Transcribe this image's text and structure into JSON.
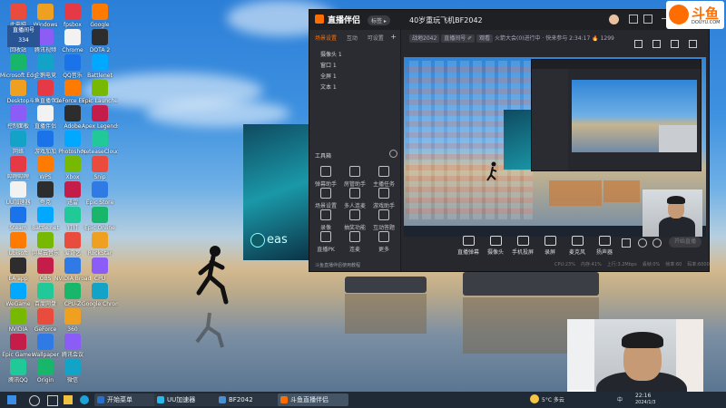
{
  "desktop": {
    "icons_col1": [
      "此电脑",
      "回收站",
      "Microsoft Edge",
      "Desktop",
      "控制面板",
      "网络",
      "哔哩哔哩",
      "UU加速器",
      "Steam",
      "Ubisoft",
      "EA app",
      "WeGame",
      "NVIDIA",
      "Epic Games",
      "腾讯QQ"
    ],
    "icons_col2": [
      "Windows",
      "腾讯视频",
      "企鹅电竞",
      "斗鱼直播伴侣",
      "直播伴侣",
      "游戏加加",
      "WPS",
      "夸克",
      "Battle.net",
      "网易云音乐",
      "OBS",
      "百度网盘",
      "GeForce",
      "Wallpaper",
      "Origin"
    ],
    "icons_col3": [
      "fpsbox",
      "Chrome",
      "QQ音乐",
      "GeForce Experience",
      "Adobe",
      "Photoshop",
      "Xbox",
      "迅雷",
      "钉钉",
      "爱奇艺",
      "NVIDIA Broadcast",
      "CPU-Z",
      "360",
      "腾讯会议",
      "微信"
    ],
    "icons_col4": [
      "Google",
      "DOTA 2",
      "Battlenet",
      "Epic Launcher",
      "Apex Legends",
      "NeteaseCloud",
      "Snip",
      "Epic Store",
      "Epic Online",
      "RockStar",
      "CPU",
      "Google Chrome"
    ],
    "cam_user_label": "直播间号",
    "cam_user_id": "334"
  },
  "streamer_app": {
    "brand": "直播伴侣",
    "badge": "标签 ▸",
    "room_title": "40岁重玩飞机BF2042",
    "room_meta_1": "战地2042",
    "room_meta_2": "直播间号 ✐",
    "room_meta_3": "观看",
    "room_meta_4": "火箭大会(0)进行中 · 快来参与",
    "room_time": "2:34:17",
    "room_viewers": "🔥 1299",
    "scene_tabs": [
      "场景设置",
      "互动",
      "可设置"
    ],
    "add_icon": "+",
    "sources": [
      "摄像头 1",
      "窗口 1",
      "全屏 1",
      "文本 1"
    ],
    "tools_header": "工具箱",
    "tools": [
      "弹幕助手",
      "房管助手",
      "主播任务",
      "场景设置",
      "多人连麦",
      "游戏助手",
      "录像",
      "抽奖功能",
      "互动答题",
      "直播PK",
      "连麦",
      "更多"
    ],
    "bottom_notice": "斗鱼直播伴侣使用教程",
    "controls": [
      "直播弹幕",
      "摄像头",
      "手机投屏",
      "录屏",
      "麦克风",
      "扬声器"
    ],
    "start_label": "开始直播",
    "status_bar": [
      "CPU:23%",
      "内存:41%",
      "上行:3.2Mbps",
      "丢帧:0%",
      "帧率:60",
      "码率:6000"
    ]
  },
  "taskbar": {
    "items": [
      "开始菜单",
      "UU加速器",
      "BF2042",
      "斗鱼直播伴侣"
    ],
    "weather": "5°C 多云",
    "lang": "中",
    "time": "22:16",
    "date": "2024/1/3"
  },
  "logo": {
    "text": "斗鱼",
    "sub": "DOUYU.COM"
  },
  "colors": {
    "accent": "#ff6d00",
    "red": "#ff3b30",
    "app_bg": "#26282d",
    "taskbar": "#1f2a36"
  }
}
